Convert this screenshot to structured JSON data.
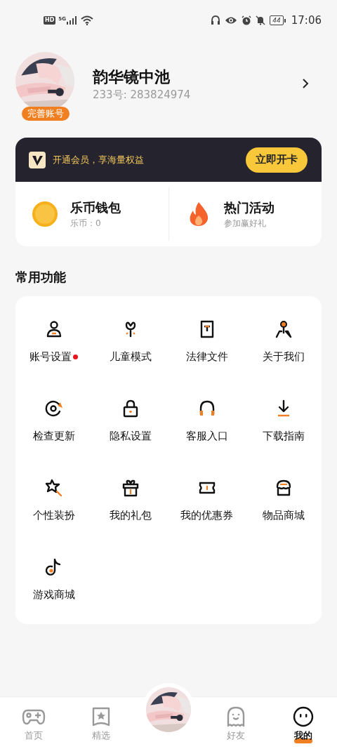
{
  "status_bar": {
    "network_badge": "HD",
    "network_type": "5G",
    "battery": "44",
    "time": "17:06"
  },
  "profile": {
    "name": "韵华镜中池",
    "id_line": "233号: 283824974",
    "badge": "完善账号"
  },
  "vip_banner": {
    "text": "开通会员，享海量权益",
    "button": "立即开卡"
  },
  "shortcuts": [
    {
      "kind": "coin",
      "title": "乐币钱包",
      "subtitle": "乐币：0"
    },
    {
      "kind": "fire",
      "title": "热门活动",
      "subtitle": "参加赢好礼"
    }
  ],
  "section_title": "常用功能",
  "functions": [
    {
      "kind": "user",
      "label": "账号设置",
      "dot": true
    },
    {
      "kind": "sprout",
      "label": "儿童模式",
      "dot": false
    },
    {
      "kind": "document",
      "label": "法律文件",
      "dot": false
    },
    {
      "kind": "pin",
      "label": "关于我们",
      "dot": false
    },
    {
      "kind": "refresh",
      "label": "检查更新",
      "dot": false
    },
    {
      "kind": "lock",
      "label": "隐私设置",
      "dot": false
    },
    {
      "kind": "headphones",
      "label": "客服入口",
      "dot": false
    },
    {
      "kind": "download",
      "label": "下载指南",
      "dot": false
    },
    {
      "kind": "wand",
      "label": "个性装扮",
      "dot": false
    },
    {
      "kind": "gift",
      "label": "我的礼包",
      "dot": false
    },
    {
      "kind": "ticket",
      "label": "我的优惠券",
      "dot": false
    },
    {
      "kind": "store",
      "label": "物品商城",
      "dot": false
    },
    {
      "kind": "note",
      "label": "游戏商城",
      "dot": false
    }
  ],
  "tabs": [
    {
      "kind": "gamepad",
      "label": "首页",
      "selected": false
    },
    {
      "kind": "star",
      "label": "精选",
      "selected": false
    },
    {
      "kind": "avatar"
    },
    {
      "kind": "ghost",
      "label": "好友",
      "selected": false
    },
    {
      "kind": "face",
      "label": "我的",
      "selected": true
    }
  ]
}
